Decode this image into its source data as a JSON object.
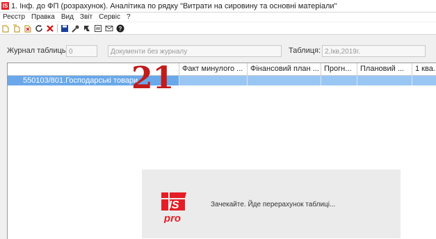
{
  "window": {
    "title": "1. Інф. до ФП (розрахунок). Аналітика по рядку \"Витрати на сировину та основні матеріали\"",
    "logo_text": "IS"
  },
  "menu": [
    "Реєстр",
    "Правка",
    "Вид",
    "Звіт",
    "Сервіс",
    "?"
  ],
  "toolbar_icons": [
    "new-document-icon",
    "copy-document-icon",
    "delete-document-icon",
    "refresh-icon",
    "close-x-icon",
    "save-icon",
    "key-icon",
    "arrow-icon",
    "preview-icon",
    "mail-icon",
    "help-icon"
  ],
  "filters": {
    "journal_label": "Журнал таблиць",
    "journal_value": "0",
    "journal_name": "Документи без журналу",
    "table_label": "Таблиця:",
    "table_value": "2,Iкв,2019г."
  },
  "grid": {
    "columns": [
      "",
      "Факт минулого ...",
      "Фінансовий план ...",
      "Прогн...",
      "Плановий ...",
      "1 ква..."
    ],
    "rows": [
      {
        "name": "550103/801.Господарські товари",
        "cells": [
          "",
          "",
          "",
          "",
          ""
        ]
      }
    ]
  },
  "annotation_number": "21",
  "loading": {
    "logo_top": "IS",
    "logo_bottom": "pro",
    "message": "Зачекайте. Йде перерахунок таблиці..."
  },
  "colors": {
    "accent_red": "#e41e26",
    "selection_blue": "#9ac6f4",
    "selection_dark": "#6aa8ea"
  }
}
